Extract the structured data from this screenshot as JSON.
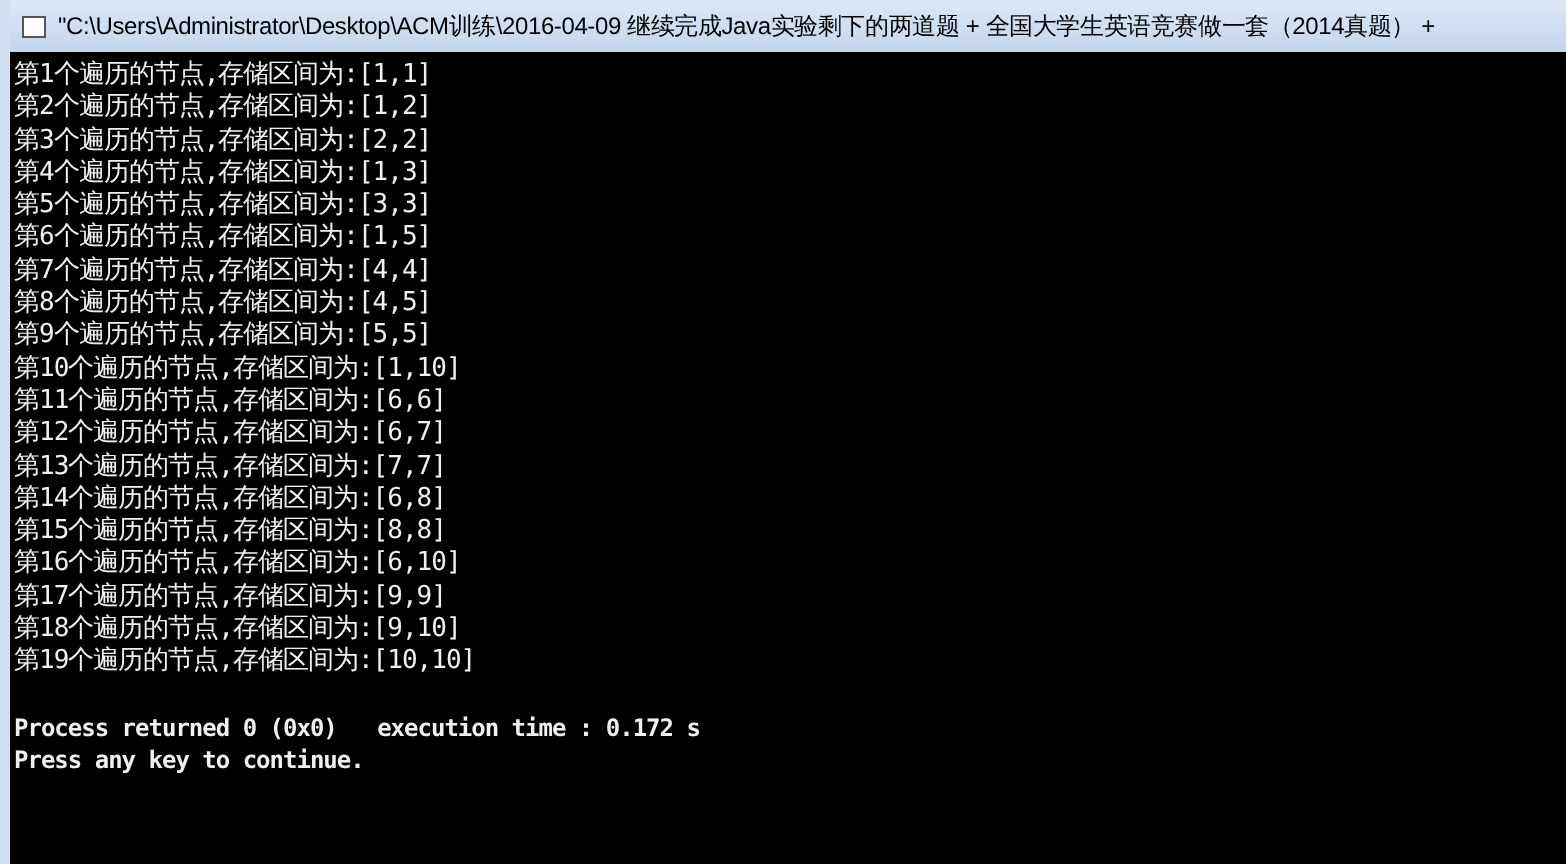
{
  "window": {
    "title": "\"C:\\Users\\Administrator\\Desktop\\ACM训练\\2016-04-09  继续完成Java实验剩下的两道题 + 全国大学生英语竞赛做一套（2014真题） +"
  },
  "console": {
    "output_lines": [
      "第1个遍历的节点,存储区间为:[1,1]",
      "第2个遍历的节点,存储区间为:[1,2]",
      "第3个遍历的节点,存储区间为:[2,2]",
      "第4个遍历的节点,存储区间为:[1,3]",
      "第5个遍历的节点,存储区间为:[3,3]",
      "第6个遍历的节点,存储区间为:[1,5]",
      "第7个遍历的节点,存储区间为:[4,4]",
      "第8个遍历的节点,存储区间为:[4,5]",
      "第9个遍历的节点,存储区间为:[5,5]",
      "第10个遍历的节点,存储区间为:[1,10]",
      "第11个遍历的节点,存储区间为:[6,6]",
      "第12个遍历的节点,存储区间为:[6,7]",
      "第13个遍历的节点,存储区间为:[7,7]",
      "第14个遍历的节点,存储区间为:[6,8]",
      "第15个遍历的节点,存储区间为:[8,8]",
      "第16个遍历的节点,存储区间为:[6,10]",
      "第17个遍历的节点,存储区间为:[9,9]",
      "第18个遍历的节点,存储区间为:[9,10]",
      "第19个遍历的节点,存储区间为:[10,10]"
    ],
    "status_lines": [
      "Process returned 0 (0x0)   execution time : 0.172 s",
      "Press any key to continue."
    ]
  }
}
